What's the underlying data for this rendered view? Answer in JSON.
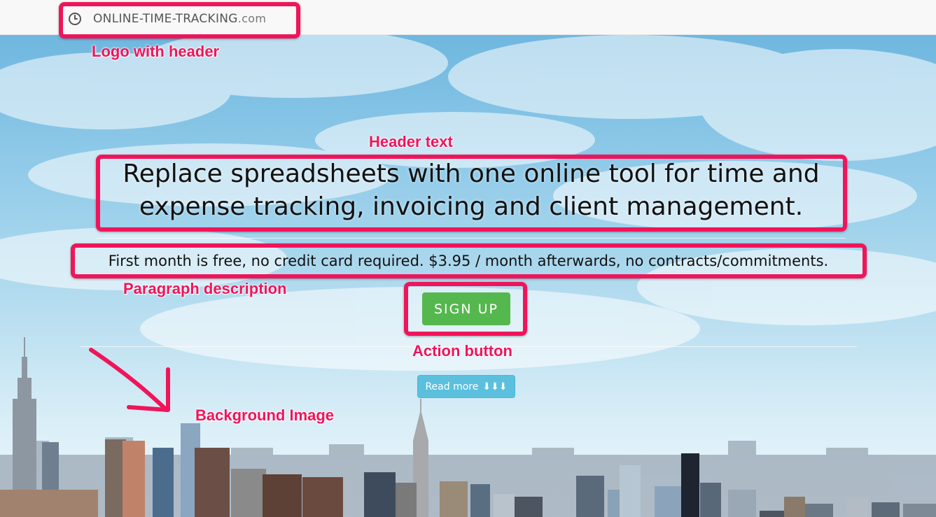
{
  "header": {
    "brand_icon": "clock-icon",
    "brand_name": "ONLINE-TIME-TRACKING",
    "brand_tld": ".com"
  },
  "hero": {
    "headline": "Replace spreadsheets with one online tool for time and expense tracking, invoicing and client management.",
    "description": "First month is free, no credit card required. $3.95 / month afterwards, no contracts/commitments.",
    "signup_label": "SIGN UP",
    "readmore_label": "Read more",
    "readmore_arrows": "⬇⬇⬇"
  },
  "annotations": {
    "logo": "Logo with header",
    "header_text": "Header text",
    "paragraph": "Paragraph description",
    "action": "Action button",
    "background": "Background Image"
  },
  "colors": {
    "annotation": "#f0145a",
    "signup_button": "#55b84e",
    "readmore_button": "#5bc0de"
  }
}
